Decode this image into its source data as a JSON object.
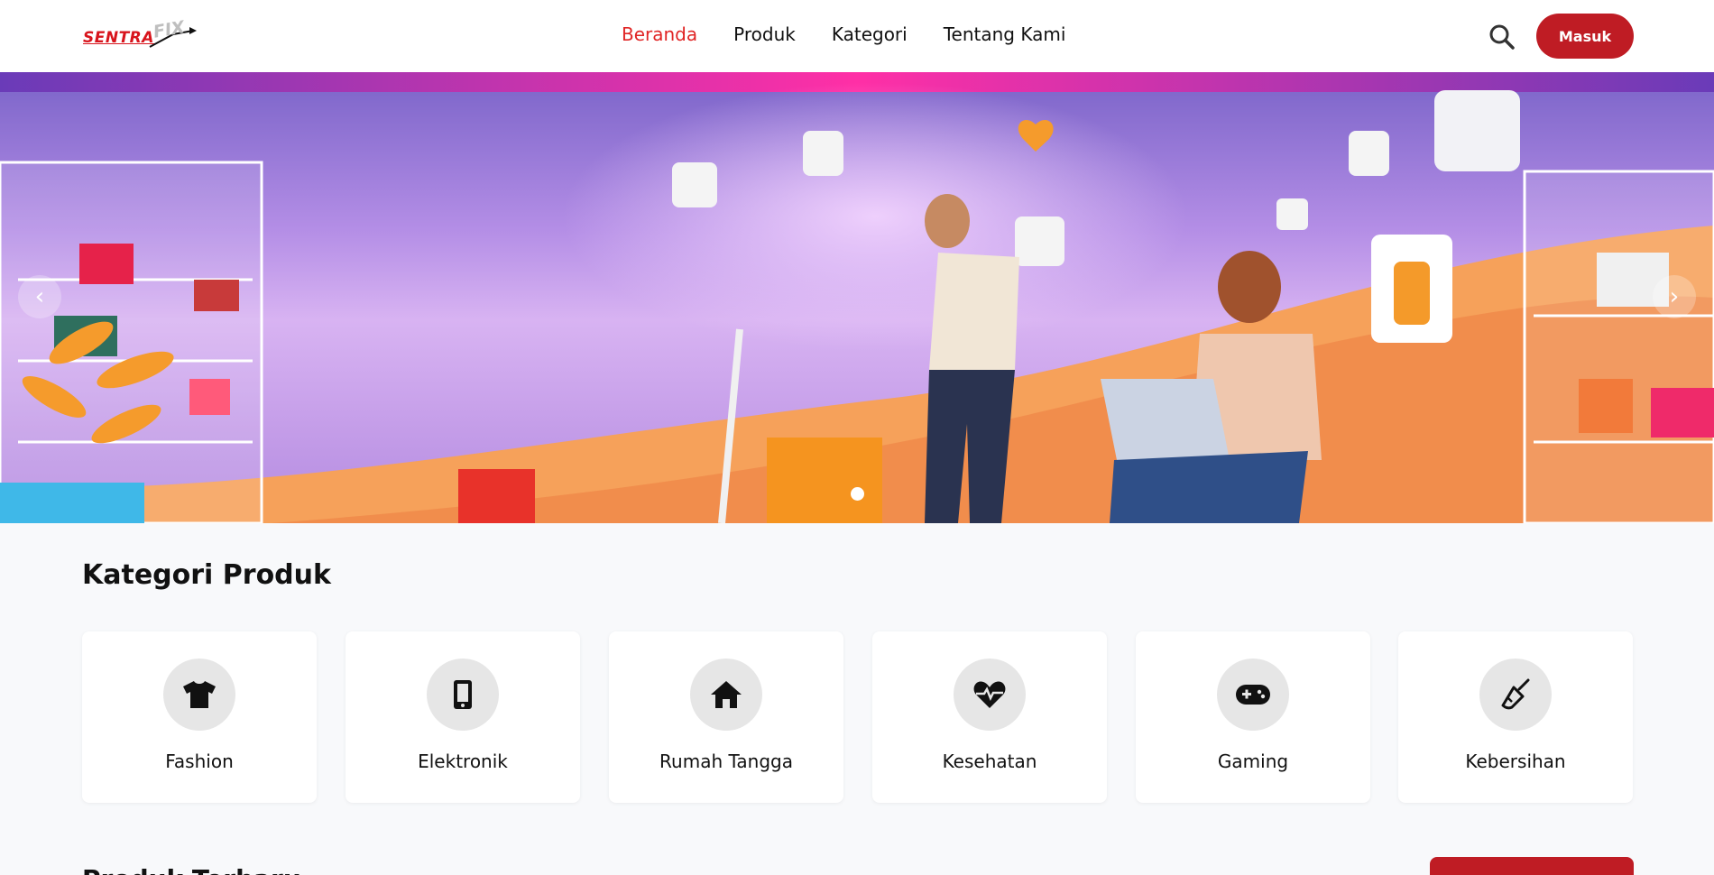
{
  "navbar": {
    "logo": {
      "text": "SENTRA",
      "accent": "FIX"
    },
    "links": [
      {
        "label": "Beranda",
        "active": true
      },
      {
        "label": "Produk",
        "active": false
      },
      {
        "label": "Kategori",
        "active": false
      },
      {
        "label": "Tentang Kami",
        "active": false
      }
    ],
    "search_icon": "search-icon",
    "login_label": "Masuk"
  },
  "hero": {
    "slides_count": 1,
    "active_slide": 1,
    "prev_icon": "chevron-left-icon",
    "next_icon": "chevron-right-icon"
  },
  "categories": {
    "title": "Kategori Produk",
    "items": [
      {
        "label": "Fashion",
        "icon": "tshirt-icon"
      },
      {
        "label": "Elektronik",
        "icon": "mobile-phone-icon"
      },
      {
        "label": "Rumah Tangga",
        "icon": "home-icon"
      },
      {
        "label": "Kesehatan",
        "icon": "heart-pulse-icon"
      },
      {
        "label": "Gaming",
        "icon": "gamepad-icon"
      },
      {
        "label": "Kebersihan",
        "icon": "broom-icon"
      }
    ]
  },
  "featured": {
    "title": "Produk Terbaru"
  },
  "colors": {
    "brand": "#bf1c24",
    "active_nav": "#e02525",
    "page_bg": "#f8f9fb"
  }
}
